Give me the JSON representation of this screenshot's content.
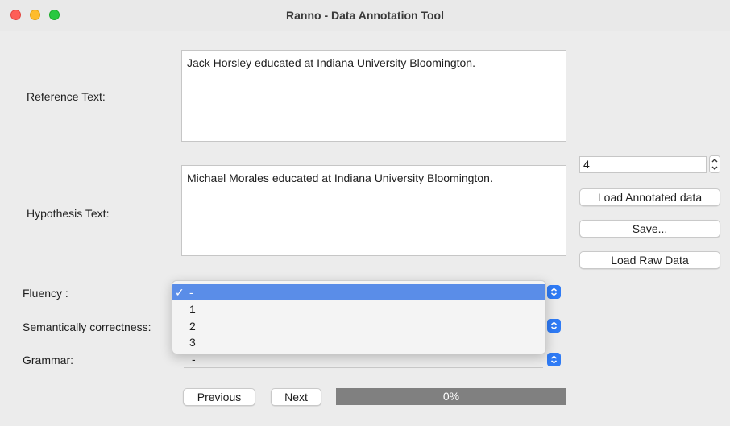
{
  "window": {
    "title": "Ranno - Data Annotation Tool"
  },
  "reference": {
    "label": "Reference Text:",
    "text": "Jack Horsley educated at Indiana University Bloomington."
  },
  "hypothesis": {
    "label": "Hypothesis Text:",
    "text": "Michael Morales educated at Indiana University Bloomington."
  },
  "controls": {
    "index_value": "4",
    "load_annotated_label": "Load Annotated data",
    "save_label": "Save...",
    "load_raw_label": "Load Raw Data"
  },
  "fluency": {
    "label": "Fluency :",
    "options": [
      "-",
      "1",
      "2",
      "3"
    ],
    "selected": "-",
    "check_glyph": "✓"
  },
  "semantic": {
    "label": "Semantically correctness:",
    "value": "-"
  },
  "grammar": {
    "label": "Grammar:",
    "value": "-"
  },
  "nav": {
    "previous_label": "Previous",
    "next_label": "Next"
  },
  "progress": {
    "value": 0,
    "text": "0%"
  },
  "colors": {
    "accent": "#2f7bf5",
    "selection": "#5a8de8",
    "progress_track": "#808080"
  }
}
